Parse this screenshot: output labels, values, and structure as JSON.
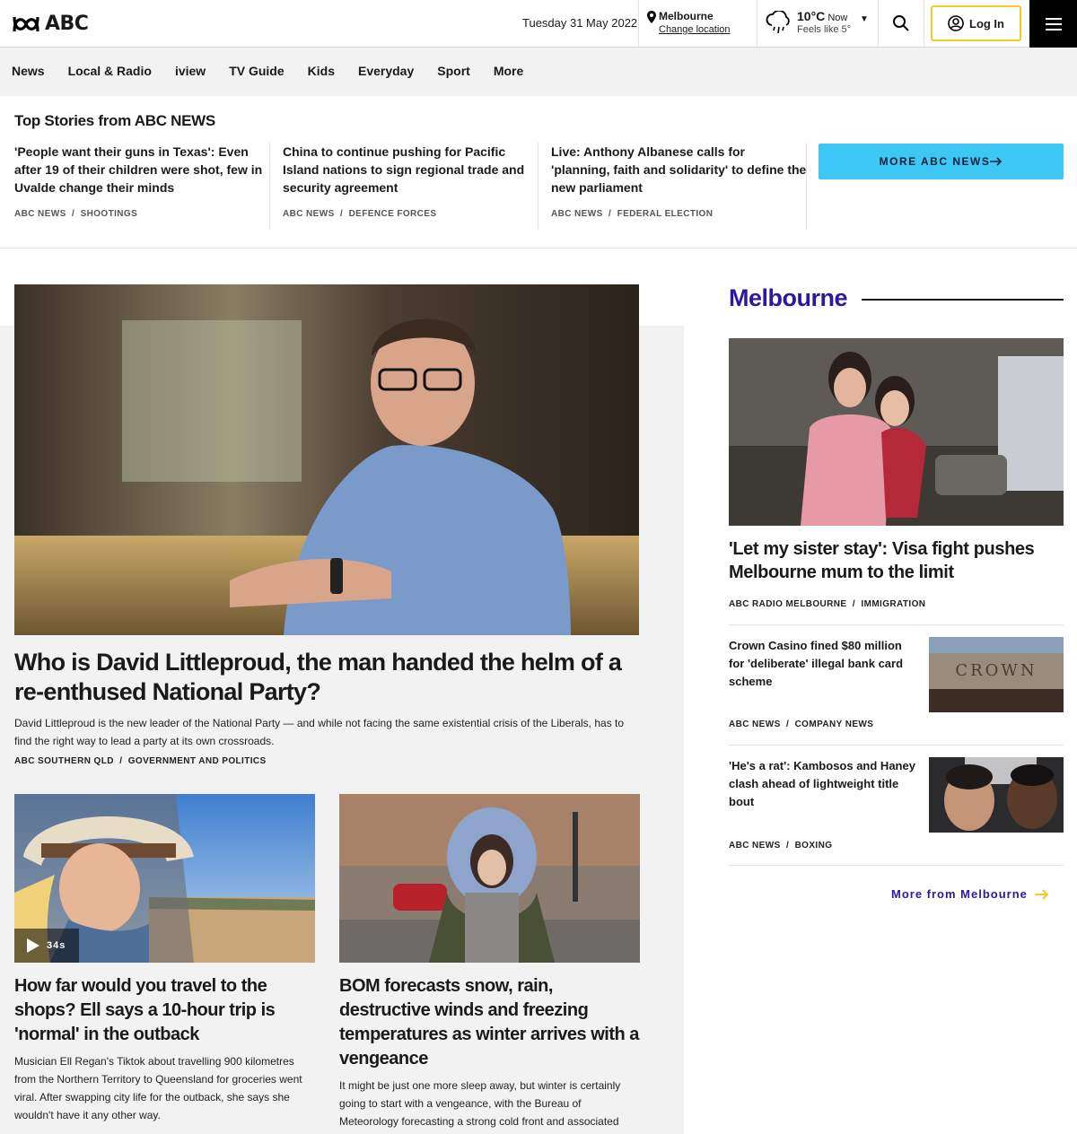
{
  "header": {
    "logo_text": "ABC",
    "date": "Tuesday 31 May 2022",
    "location_city": "Melbourne",
    "location_change": "Change location",
    "weather_temp": "10°C",
    "weather_now": "Now",
    "weather_feels": "Feels like 5°",
    "login_label": "Log In"
  },
  "nav": {
    "items": [
      "News",
      "Local & Radio",
      "iview",
      "TV Guide",
      "Kids",
      "Everyday",
      "Sport",
      "More"
    ]
  },
  "top_stories": {
    "title": "Top Stories from ABC NEWS",
    "items": [
      {
        "headline": "'People want their guns in Texas': Even after 19 of their children were shot, few in Uvalde change their minds",
        "source": "ABC NEWS",
        "topic": "SHOOTINGS"
      },
      {
        "headline": "China to continue pushing for Pacific Island nations to sign regional trade and security agreement",
        "source": "ABC NEWS",
        "topic": "DEFENCE FORCES"
      },
      {
        "headline": "Live: Anthony Albanese calls for 'planning, faith and solidarity' to define the new parliament",
        "source": "ABC NEWS",
        "topic": "FEDERAL ELECTION"
      }
    ],
    "more_label": "MORE ABC NEWS"
  },
  "hero": {
    "title": "Who is David Littleproud, the man handed the helm of a re-enthused National Party?",
    "description": "David Littleproud is the new leader of the National Party — and while not facing the same existential crisis of the Liberals, has to find the right way to lead a party at its own crossroads.",
    "source": "ABC SOUTHERN QLD",
    "topic": "GOVERNMENT AND POLITICS"
  },
  "cards": [
    {
      "title": "How far would you travel to the shops? Ell says a 10-hour trip is 'normal' in the outback",
      "description": "Musician Ell Regan's Tiktok about travelling 900 kilometres from the Northern Territory to Queensland for groceries went viral. After swapping city life for the outback, she says she wouldn't have it any other way.",
      "video_duration": "34s"
    },
    {
      "title": "BOM forecasts snow, rain, destructive winds and freezing temperatures as winter arrives with a vengeance",
      "description": "It might be just one more sleep away, but winter is certainly going to start with a vengeance, with the Bureau of Meteorology forecasting a strong cold front and associated"
    }
  ],
  "melbourne": {
    "title": "Melbourne",
    "lead_headline": "'Let my sister stay': Visa fight pushes Melbourne mum to the limit",
    "lead_source": "ABC RADIO MELBOURNE",
    "lead_topic": "IMMIGRATION",
    "stories": [
      {
        "headline": "Crown Casino fined $80 million for 'deliberate' illegal bank card scheme",
        "source": "ABC NEWS",
        "topic": "COMPANY NEWS",
        "thumb_text": "CROWN"
      },
      {
        "headline": "'He's a rat': Kambosos and Haney clash ahead of lightweight title bout",
        "source": "ABC NEWS",
        "topic": "BOXING"
      }
    ],
    "more_label": "More from Melbourne"
  },
  "colors": {
    "accent_blue": "#3cc7f5",
    "login_border": "#f5c924",
    "melbourne_purple": "#2f17a3",
    "arrow_yellow": "#f5c924"
  }
}
